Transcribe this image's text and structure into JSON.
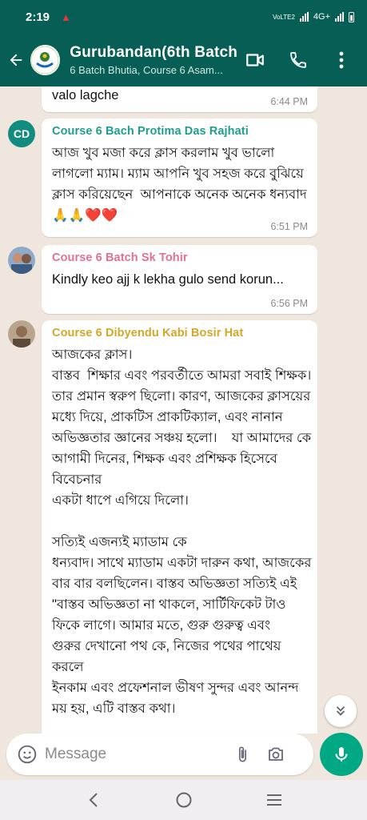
{
  "status_bar": {
    "time": "2:19",
    "network": "4G+",
    "volte": "VoLTE2"
  },
  "header": {
    "title": "Gurubandan(6th Batch",
    "subtitle": "6 Batch Bhutia, Course 6 Asam..."
  },
  "messages": [
    {
      "text": "valo lagche",
      "time": "6:44 PM"
    },
    {
      "avatar_text": "CD",
      "sender": "Course 6 Bach Protima Das Rajhati",
      "sender_color": "#1f9e8c",
      "text": "আজ খুব মজা করে ক্লাস করলাম খুব ভালো লাগলো ম্যাম। ম্যাম আপনি খুব সহজ করে বুঝিয়ে ক্লাস করিয়েছেন  আপনাকে অনেক অনেক ধন্যবাদ 🙏🙏❤️❤️",
      "time": "6:51 PM"
    },
    {
      "sender": "Course 6 Batch Sk Tohir",
      "sender_color": "#e0709a",
      "text": "Kindly keo ajj k lekha gulo send korun...",
      "time": "6:56 PM"
    },
    {
      "sender": "Course 6 Dibyendu Kabi Bosir Hat",
      "sender_color": "#d4a62a",
      "text": "আজকের ক্লাস।\nবাস্তব  শিক্ষার এবং পরবর্তীতে আমরা সবাই শিক্ষক। তার প্রমান স্বরুপ ছিলো। কারণ, আজকের ক্লাসয়ের মধ্যে দিয়ে, প্রাকটিস প্রাকটিক্যাল, এবং নানান অভিজ্ঞতার জ্ঞানের সঞ্চয় হলো।    যা আমাদের কে আগামী দিনের, শিক্ষক এবং প্রশিক্ষক হিসেবে বিবেচনার\nএকটা ধাপে এগিয়ে দিলো।\n\nসত্যিই এজন্যই ম্যাডাম কে\nধন্যবাদ। সাথে ম্যাডাম একটা দারুন কথা, আজকের বার বার বলছিলেন। বাস্তব অভিজ্ঞতা সত্যিই এই \"বাস্তব অভিজ্ঞতা না থাকলে, সার্টিফিকেট টাও ফিকে লাগে। আমার মতে, গুরু গুরুত্ব এবং\nগুরুর দেখানো পথ কে, নিজের পথের পাথেয় করলে\nইনকাম এবং প্রফেশনাল ভীষণ সুন্দর এবং আনন্দ ময় হয়, এটি বাস্তব কথা।"
    }
  ],
  "composer": {
    "placeholder": "Message"
  },
  "colors": {
    "header_bg": "#075e54",
    "chat_bg": "#efe7de",
    "mic_bg": "#00a884"
  },
  "icons": [
    "back-arrow-icon",
    "video-call-icon",
    "phone-icon",
    "more-options-icon",
    "emoji-icon",
    "attach-icon",
    "camera-icon",
    "mic-icon",
    "double-chevron-down-icon",
    "nav-back-icon",
    "nav-home-icon",
    "nav-recents-icon"
  ]
}
